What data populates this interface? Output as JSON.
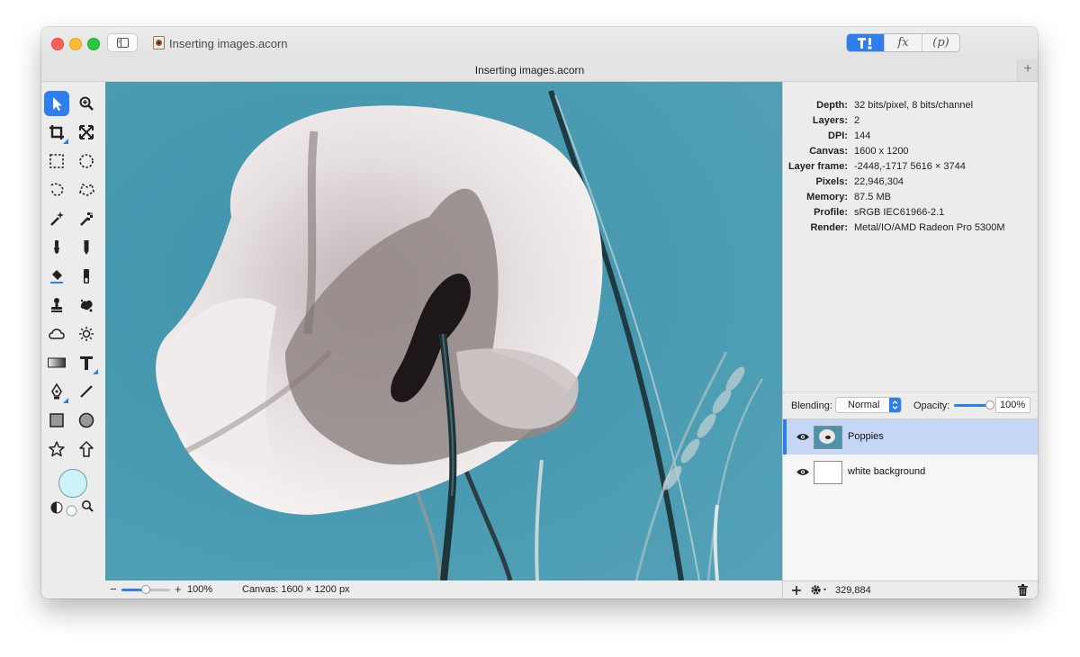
{
  "window": {
    "title": "Inserting images.acorn",
    "doc_tab_title": "Inserting images.acorn"
  },
  "toolbar_segments": [
    {
      "label": "",
      "icon": "tools-icon",
      "active": true
    },
    {
      "label": "fx",
      "icon": "effects-icon",
      "active": false
    },
    {
      "label": "(p)",
      "icon": "properties-icon",
      "active": false
    }
  ],
  "tab_add_label": "+",
  "tools": [
    "arrow-select-icon",
    "zoom-icon",
    "crop-icon",
    "transform-icon",
    "rect-marquee-icon",
    "ellipse-marquee-icon",
    "lasso-icon",
    "polygon-lasso-icon",
    "magic-wand-icon",
    "instant-alpha-icon",
    "brush-icon",
    "pencil-icon",
    "paint-bucket-icon",
    "eraser-icon",
    "clone-stamp-icon",
    "smudge-icon",
    "cloud-icon",
    "sun-icon",
    "gradient-icon",
    "text-icon",
    "pen-icon",
    "line-icon",
    "rectangle-shape-icon",
    "oval-shape-icon",
    "star-shape-icon",
    "arrow-shape-icon"
  ],
  "colors": {
    "accent": "#2d7ff0",
    "canvas_bg": "#4a93a8",
    "color_well": "#cdf4fb"
  },
  "info": [
    {
      "label": "Depth:",
      "value": "32 bits/pixel, 8 bits/channel"
    },
    {
      "label": "Layers:",
      "value": "2"
    },
    {
      "label": "DPI:",
      "value": "144"
    },
    {
      "label": "Canvas:",
      "value": "1600 x 1200"
    },
    {
      "label": "Layer frame:",
      "value": "-2448,-1717 5616 × 3744"
    },
    {
      "label": "Pixels:",
      "value": "22,946,304"
    },
    {
      "label": "Memory:",
      "value": "87.5 MB"
    },
    {
      "label": "Profile:",
      "value": "sRGB IEC61966-2.1"
    },
    {
      "label": "Render:",
      "value": "Metal/IO/AMD Radeon Pro 5300M"
    }
  ],
  "blending": {
    "label": "Blending:",
    "value": "Normal",
    "opacity_label": "Opacity:",
    "opacity_value": "100%",
    "opacity_fraction": 1.0
  },
  "layers": [
    {
      "name": "Poppies",
      "selected": true
    },
    {
      "name": "white background",
      "selected": false
    }
  ],
  "layers_footer": {
    "count": "329,884"
  },
  "status": {
    "zoom_minus": "−",
    "zoom_plus": "+",
    "zoom": "100%",
    "zoom_fraction": 0.5,
    "canvas": "Canvas: 1600 × 1200 px"
  }
}
